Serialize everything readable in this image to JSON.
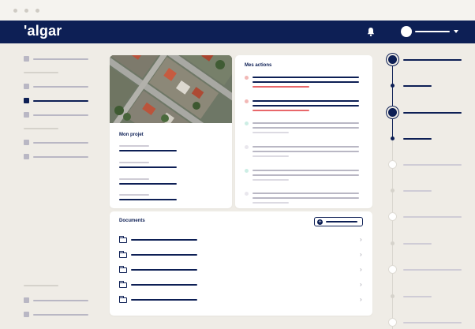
{
  "window": {
    "controls": [
      "close",
      "minimize",
      "maximize"
    ]
  },
  "header": {
    "brand": "'algar",
    "icons": [
      "bell-icon",
      "chevron-down-icon"
    ]
  },
  "projet": {
    "title": "Mon projet"
  },
  "actions": {
    "title": "Mes actions"
  },
  "documents": {
    "title": "Documents",
    "row_count": 5
  },
  "colors": {
    "navy": "#0d1f55",
    "accent_red": "#e8676a",
    "mint": "#9ed8c9",
    "background": "#efece6",
    "skeleton_grey": "#cfccd6"
  }
}
